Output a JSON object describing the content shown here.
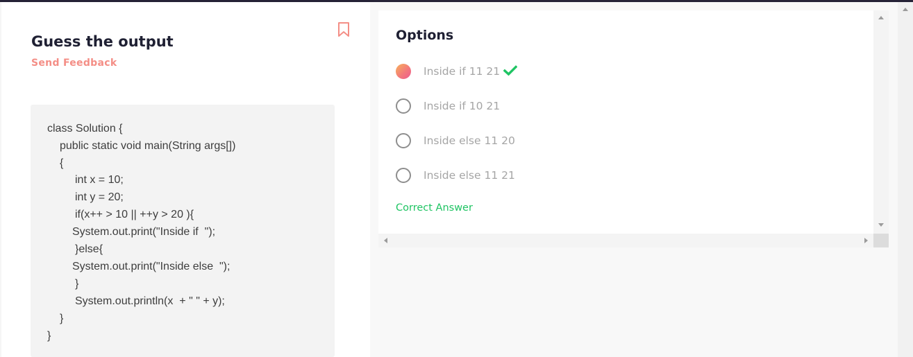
{
  "question": {
    "title": "Guess the output",
    "feedback_link": "Send Feedback",
    "bookmark_icon": "bookmark-icon",
    "code_lines": [
      "class Solution {",
      "public static void main(String args[])",
      "{",
      "int x = 10;",
      "int y = 20;",
      "if(x++ > 10 || ++y > 20 ){",
      "System.out.print(\"Inside if  \");",
      "}else{",
      "System.out.print(\"Inside else  \");",
      "}",
      "System.out.println(x  + \" \" + y);",
      "}",
      "}"
    ]
  },
  "options": {
    "title": "Options",
    "items": [
      {
        "label": "Inside if 11 21",
        "selected": true,
        "correct": true
      },
      {
        "label": "Inside if 10 21",
        "selected": false,
        "correct": false
      },
      {
        "label": "Inside else 11 20",
        "selected": false,
        "correct": false
      },
      {
        "label": "Inside else 11 21",
        "selected": false,
        "correct": false
      }
    ],
    "correct_answer_text": "Correct Answer"
  },
  "colors": {
    "accent": "#f48e86",
    "correct": "#1fc463",
    "title": "#1f2033"
  }
}
